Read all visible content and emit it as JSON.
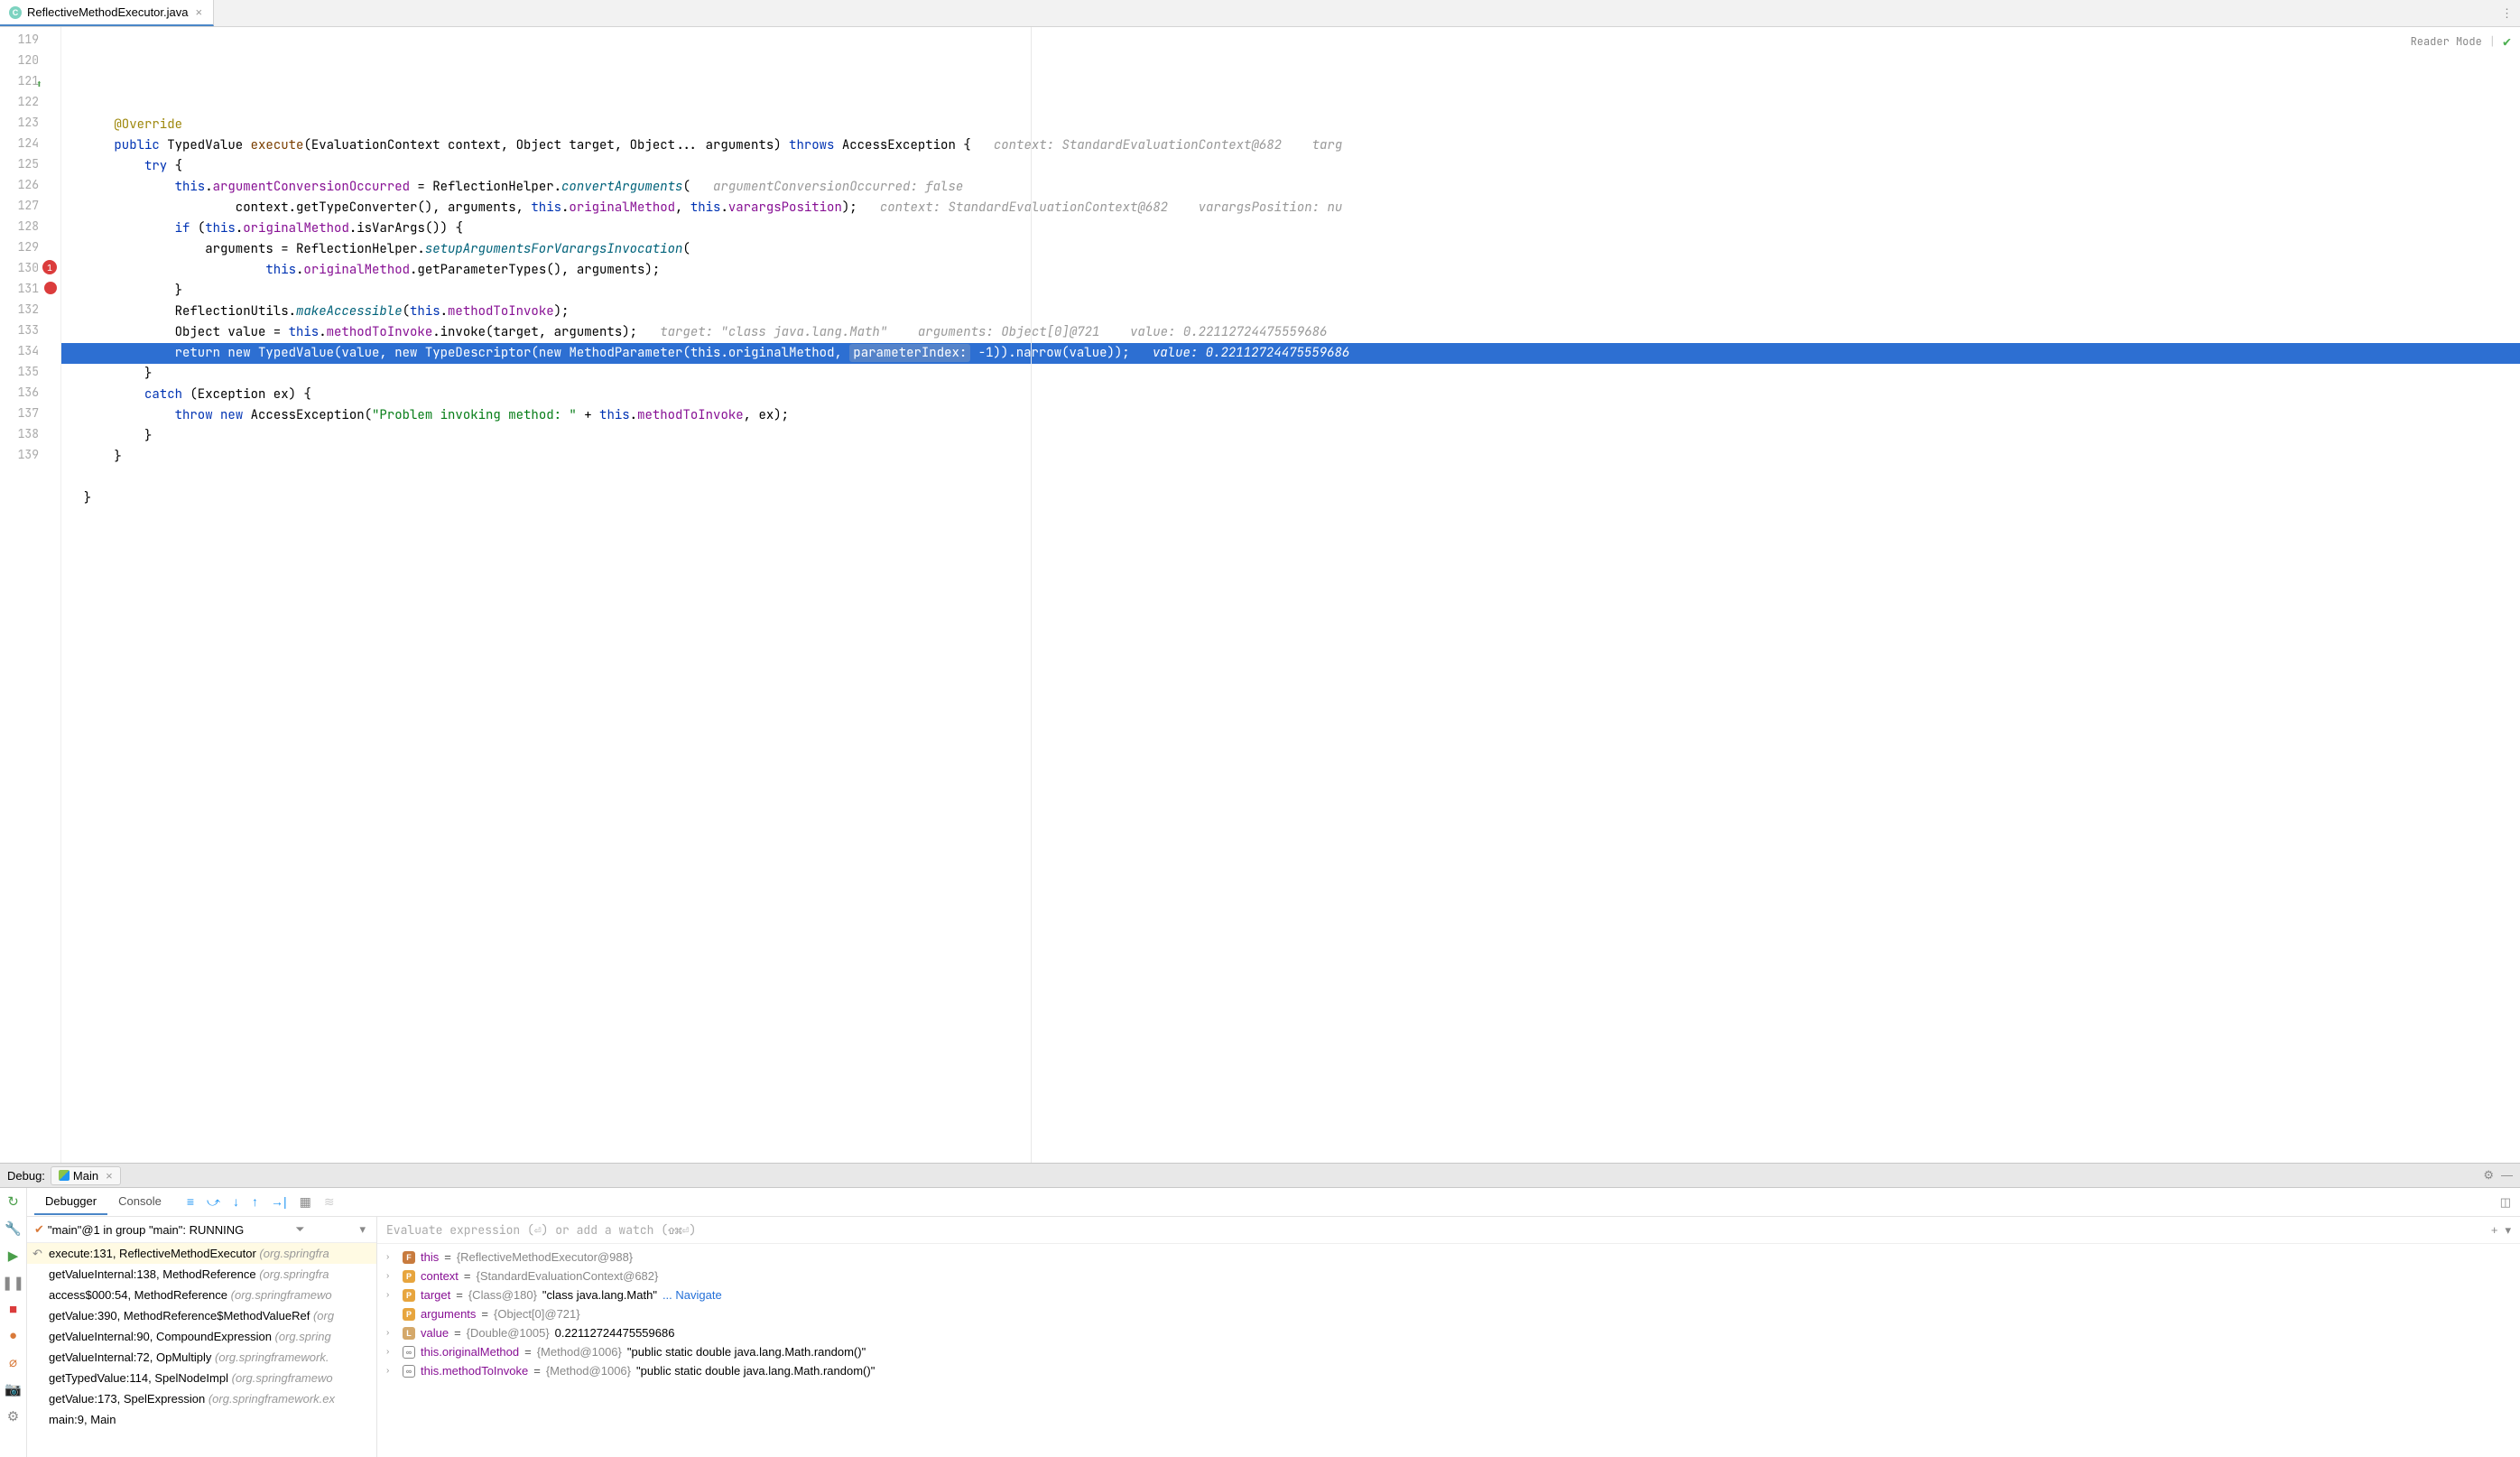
{
  "tab": {
    "filename": "ReflectiveMethodExecutor.java"
  },
  "reader_mode": "Reader Mode",
  "gutter_start": 119,
  "gutter_end": 139,
  "code_lines": {
    "119": "",
    "120": "      @Override",
    "121": "      public TypedValue execute(EvaluationContext context, Object target, Object... arguments) throws AccessException {",
    "121_hint": "context: StandardEvaluationContext@682    targ",
    "122": "          try {",
    "123": "              this.argumentConversionOccurred = ReflectionHelper.convertArguments(",
    "123_hint": "argumentConversionOccurred: false",
    "124": "                      context.getTypeConverter(), arguments, this.originalMethod, this.varargsPosition);",
    "124_hint": "context: StandardEvaluationContext@682    varargsPosition: nu",
    "125": "              if (this.originalMethod.isVarArgs()) {",
    "126": "                  arguments = ReflectionHelper.setupArgumentsForVarargsInvocation(",
    "127": "                          this.originalMethod.getParameterTypes(), arguments);",
    "128": "              }",
    "129": "              ReflectionUtils.makeAccessible(this.methodToInvoke);",
    "130": "              Object value = this.methodToInvoke.invoke(target, arguments);",
    "130_hint": "target: \"class java.lang.Math\"    arguments: Object[0]@721    value: 0.22112724475559686",
    "131": "              return new TypedValue(value, new TypeDescriptor(new MethodParameter(this.originalMethod, ",
    "131_param": "parameterIndex:",
    "131_tail": " -1)).narrow(value));",
    "131_hint": "value: 0.22112724475559686",
    "132": "          }",
    "133": "          catch (Exception ex) {",
    "134": "              throw new AccessException(\"Problem invoking method: \" + this.methodToInvoke, ex);",
    "135": "          }",
    "136": "      }",
    "137": "",
    "138": "  }",
    "139": ""
  },
  "debug": {
    "label": "Debug:",
    "run_config": "Main",
    "tabs": {
      "debugger": "Debugger",
      "console": "Console"
    },
    "thread": "\"main\"@1 in group \"main\": RUNNING",
    "frames": [
      {
        "text": "execute:131, ReflectiveMethodExecutor",
        "pkg": "(org.springfra",
        "sel": true
      },
      {
        "text": "getValueInternal:138, MethodReference",
        "pkg": "(org.springfra"
      },
      {
        "text": "access$000:54, MethodReference",
        "pkg": "(org.springframewo"
      },
      {
        "text": "getValue:390, MethodReference$MethodValueRef",
        "pkg": "(org"
      },
      {
        "text": "getValueInternal:90, CompoundExpression",
        "pkg": "(org.spring"
      },
      {
        "text": "getValueInternal:72, OpMultiply",
        "pkg": "(org.springframework."
      },
      {
        "text": "getTypedValue:114, SpelNodeImpl",
        "pkg": "(org.springframewo"
      },
      {
        "text": "getValue:173, SpelExpression",
        "pkg": "(org.springframework.ex"
      },
      {
        "text": "main:9, Main",
        "pkg": ""
      }
    ],
    "eval_placeholder": "Evaluate expression (⏎) or add a watch (⇧⌘⏎)",
    "vars": [
      {
        "icon": "f",
        "name": "this",
        "type": "{ReflectiveMethodExecutor@988}",
        "val": "",
        "expand": true
      },
      {
        "icon": "p",
        "name": "context",
        "type": "{StandardEvaluationContext@682}",
        "val": "",
        "expand": true
      },
      {
        "icon": "p",
        "name": "target",
        "type": "{Class@180}",
        "val": "\"class java.lang.Math\"",
        "link": "... Navigate",
        "expand": true
      },
      {
        "icon": "p",
        "name": "arguments",
        "type": "{Object[0]@721}",
        "val": "",
        "expand": false
      },
      {
        "icon": "l",
        "name": "value",
        "type": "{Double@1005}",
        "val": "0.22112724475559686",
        "expand": true
      },
      {
        "icon": "m",
        "name": "this.originalMethod",
        "type": "{Method@1006}",
        "val": "\"public static double java.lang.Math.random()\"",
        "expand": true
      },
      {
        "icon": "m",
        "name": "this.methodToInvoke",
        "type": "{Method@1006}",
        "val": "\"public static double java.lang.Math.random()\"",
        "expand": true
      }
    ]
  }
}
